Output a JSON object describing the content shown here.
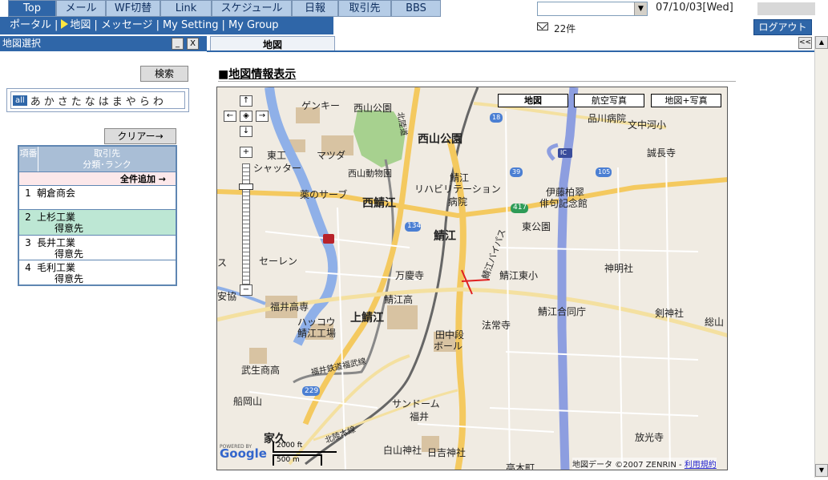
{
  "topnav": [
    {
      "label": "Top",
      "active": true
    },
    {
      "label": "メール"
    },
    {
      "label": "WF切替"
    },
    {
      "label": "Link"
    },
    {
      "label": "スケジュール"
    },
    {
      "label": "日報"
    },
    {
      "label": "取引先"
    },
    {
      "label": "BBS"
    }
  ],
  "subnav": {
    "portal": "ポータル",
    "map": "地図",
    "message": "メッセージ",
    "my_setting": "My Setting",
    "my_group": "My Group"
  },
  "header": {
    "date": "07/10/03[Wed]",
    "mail_count": "22件",
    "logout": "ログアウト"
  },
  "left": {
    "title": "地図選択",
    "minimize": "_",
    "close": "X",
    "search_button": "検索",
    "kana_all": "all",
    "kana": [
      "あ",
      "か",
      "さ",
      "た",
      "な",
      "は",
      "ま",
      "や",
      "ら",
      "わ"
    ],
    "clear_button": "クリアー→",
    "table": {
      "col_no": "項番",
      "col_name_line1": "取引先",
      "col_name_line2": "分類･ランク",
      "add_all": "全件追加 →",
      "rows": [
        {
          "no": "1",
          "name": "朝倉商会",
          "category": ""
        },
        {
          "no": "2",
          "name": "上杉工業",
          "category": "得意先"
        },
        {
          "no": "3",
          "name": "長井工業",
          "category": "得意先"
        },
        {
          "no": "4",
          "name": "毛利工業",
          "category": "得意先"
        }
      ]
    }
  },
  "right": {
    "tab": "地図",
    "section_title_prefix": "■",
    "section_title": "地図情報表示",
    "collapse": "<<"
  },
  "map": {
    "types": {
      "map": "地図",
      "aerial": "航空写真",
      "hybrid": "地図+写真"
    },
    "controls": {
      "up": "↑",
      "down": "↓",
      "left": "←",
      "right": "→",
      "center": "◈",
      "zoom_in": "+",
      "zoom_out": "−"
    },
    "labels": {
      "genki": "ゲンキー",
      "nishiyama": "西山公園",
      "nishiyama_big": "西山公園",
      "hokuriku_do": "北陸道",
      "shinagawa": "品川病院",
      "bunnakagawa": "文中河小",
      "seiei": "誠長寺",
      "higashi": "東工",
      "shatter": "シャッター",
      "matsuda": "マツダ",
      "zoo": "西山動物園",
      "sabae_reha1": "鯖江",
      "sabae_reha2": "リハビリテーション",
      "sabae_reha3": "病院",
      "ito1": "伊藤柏翠",
      "ito2": "俳句記念館",
      "kusuri": "薬のサーブ",
      "nishisabae": "西鯖江",
      "r417": "417",
      "higashikoen": "東公園",
      "r134": "134",
      "sabae": "鯖江",
      "bypass": "鯖江バイパス",
      "seiren": "セーレン",
      "shinmei": "神明社",
      "manjuji": "万慶寺",
      "sabaehigashi": "鯖江東小",
      "fukui_high": "福井高専",
      "kamisabae": "上鯖江",
      "sabae_high": "鯖江高",
      "sabaegodo": "鯖江合同庁",
      "tsurugi": "剣神社",
      "hakkou1": "ハッコウ",
      "hakkou2": "鯖江工場",
      "hojoji": "法常寺",
      "tanaka1": "田中段",
      "tanaka2": "ボール",
      "sozan": "総山",
      "takefu": "武生商高",
      "fukui_rail": "福井鉄道福武線",
      "r229": "229",
      "funaoka": "船岡山",
      "sundome": "サンドーム",
      "fukui": "福井",
      "ieku": "家久",
      "hokuriku_line": "北陸本線",
      "shirayama": "白山神社",
      "hiyoshi": "日吉神社",
      "koushoji": "放光寺",
      "takaki": "高木町",
      "anchoku": "安協",
      "su": "ス",
      "ic": "IC",
      "r18": "18",
      "r39": "39",
      "r105": "105"
    },
    "credits": "地図データ ©2007 ZENRIN -",
    "terms": "利用規約",
    "scale_ft": "2000 ft",
    "scale_m": "500 m",
    "logo": "Google",
    "powered_by": "POWERED BY"
  },
  "colors": {
    "nav_blue": "#2f66a8",
    "nav_light": "#b5cce6",
    "highway": "#8d9ee0",
    "main_road": "#f4c95f",
    "river": "#8fb0e8",
    "park": "#a7d18f",
    "building": "#d8c3a2",
    "marker": "#e02020"
  },
  "icons": [
    "play-icon",
    "mail-icon",
    "dropdown-arrow-icon",
    "map-marker-icon",
    "restaurant-icon",
    "temple-icon",
    "school-icon",
    "shrine-icon",
    "scroll-up-icon",
    "scroll-down-icon"
  ]
}
